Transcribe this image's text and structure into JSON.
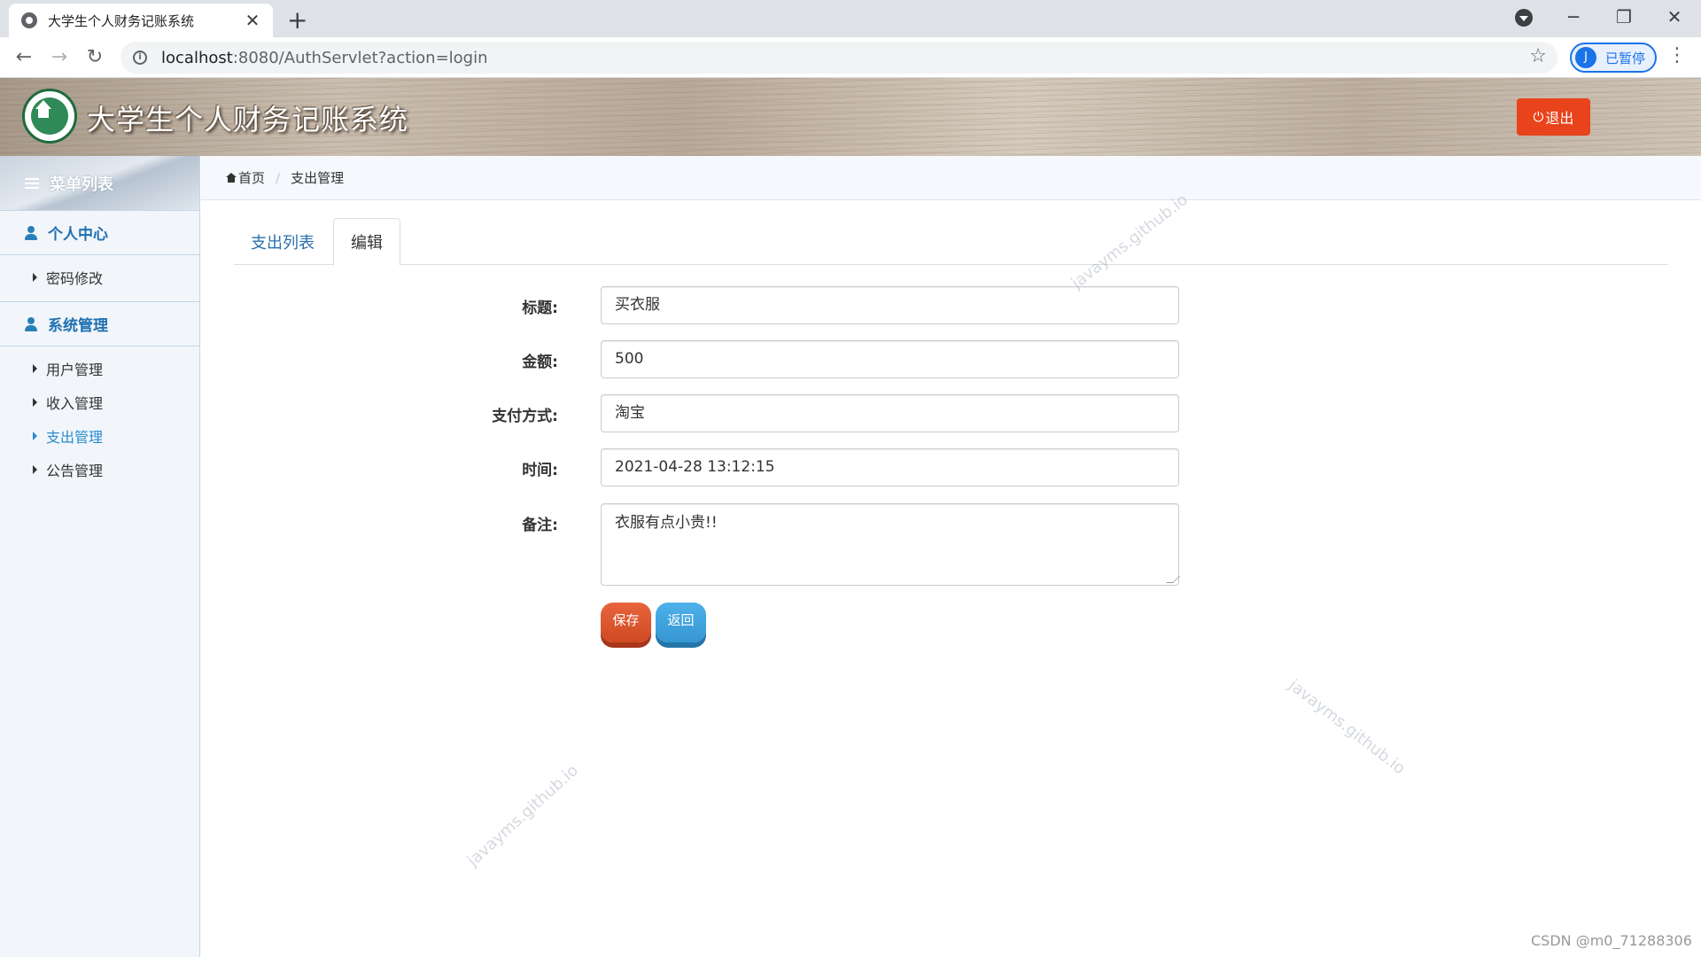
{
  "browser": {
    "tab_title": "大学生个人财务记账系统",
    "tab_close": "✕",
    "new_tab": "+",
    "url_host": "localhost",
    "url_rest": ":8080/AuthServlet?action=login",
    "profile_initial": "J",
    "profile_label": "已暂停",
    "icons": [
      "back-icon",
      "forward-icon",
      "reload-icon",
      "info-icon",
      "star-icon",
      "menu-icon"
    ]
  },
  "header": {
    "title": "大学生个人财务记账系统",
    "logout_label": "退出",
    "logout_icon": "⏻"
  },
  "sidebar": {
    "heading": "菜单列表",
    "groups": [
      {
        "label": "个人中心",
        "items": [
          {
            "label": "密码修改"
          }
        ]
      },
      {
        "label": "系统管理",
        "items": [
          {
            "label": "用户管理"
          },
          {
            "label": "收入管理"
          },
          {
            "label": "支出管理",
            "active": true
          },
          {
            "label": "公告管理"
          }
        ]
      }
    ]
  },
  "breadcrumb": {
    "home": "首页",
    "separator": "/",
    "current": "支出管理"
  },
  "tabs": [
    {
      "label": "支出列表"
    },
    {
      "label": "编辑",
      "active": true
    }
  ],
  "form": {
    "title_label": "标题:",
    "title_value": "买衣服",
    "amount_label": "金额:",
    "amount_value": "500",
    "payment_label": "支付方式:",
    "payment_value": "淘宝",
    "time_label": "时间:",
    "time_value": "2021-04-28 13:12:15",
    "note_label": "备注:",
    "note_value": "衣服有点小贵!!",
    "save_label": "保存",
    "back_label": "返回"
  },
  "watermark": "javayms.github.io",
  "csdn_credit": "CSDN @m0_71288306",
  "colors": {
    "accent": "#2a8bd0",
    "logout": "#e8431b",
    "save": "#d9542b",
    "back": "#3fa3de"
  }
}
